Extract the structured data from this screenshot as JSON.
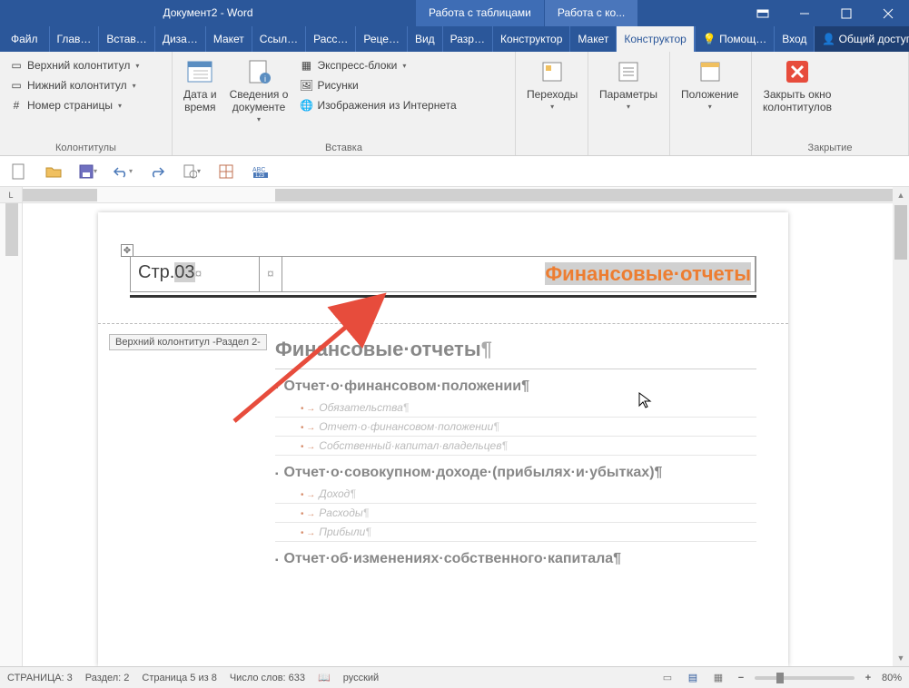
{
  "titlebar": {
    "title": "Документ2 - Word",
    "ctx_tabs": [
      "Работа с таблицами",
      "Работа с ко..."
    ]
  },
  "tabs": {
    "file": "Файл",
    "items": [
      "Глав…",
      "Встав…",
      "Диза…",
      "Макет",
      "Ссыл…",
      "Расс…",
      "Реце…",
      "Вид",
      "Разр…",
      "Конструктор",
      "Макет",
      "Конструктор"
    ],
    "active_index": 11,
    "help": "Помощ…",
    "signin": "Вход",
    "share": "Общий доступ"
  },
  "ribbon": {
    "group1": {
      "label": "Колонтитулы",
      "top_header": "Верхний колонтитул",
      "bottom_header": "Нижний колонтитул",
      "page_number": "Номер страницы"
    },
    "group2": {
      "label": "Вставка",
      "date_time": "Дата и\nвремя",
      "doc_info": "Сведения о\nдокументе",
      "quick_parts": "Экспресс-блоки",
      "pictures": "Рисунки",
      "online_pics": "Изображения из Интернета"
    },
    "group3": {
      "nav": "Переходы"
    },
    "group4": {
      "options": "Параметры"
    },
    "group5": {
      "position": "Положение"
    },
    "group6": {
      "label": "Закрытие",
      "close": "Закрыть окно\nколонтитулов"
    }
  },
  "doc": {
    "header_page_prefix": "Стр.",
    "header_page_num": "03",
    "header_mark": "¤",
    "header_title": "Финансовые·отчеты",
    "header_tag": "Верхний колонтитул -Раздел 2-",
    "h1": "Финансовые·отчеты",
    "sec1": "Отчет·о·финансовом·положении",
    "sec1_items": [
      "Обязательства",
      "Отчет·о·финансовом·положении",
      "Собственный·капитал·владельцев"
    ],
    "sec2": "Отчет·о·совокупном·доходе·(прибылях·и·убытках)",
    "sec2_items": [
      "Доход",
      "Расходы",
      "Прибыли"
    ],
    "sec3": "Отчет·об·изменениях·собственного·капитала",
    "pm": "¶"
  },
  "status": {
    "page": "СТРАНИЦА: 3",
    "section": "Раздел: 2",
    "page_of": "Страница 5 из 8",
    "words": "Число слов: 633",
    "lang": "русский",
    "zoom": "80%"
  }
}
